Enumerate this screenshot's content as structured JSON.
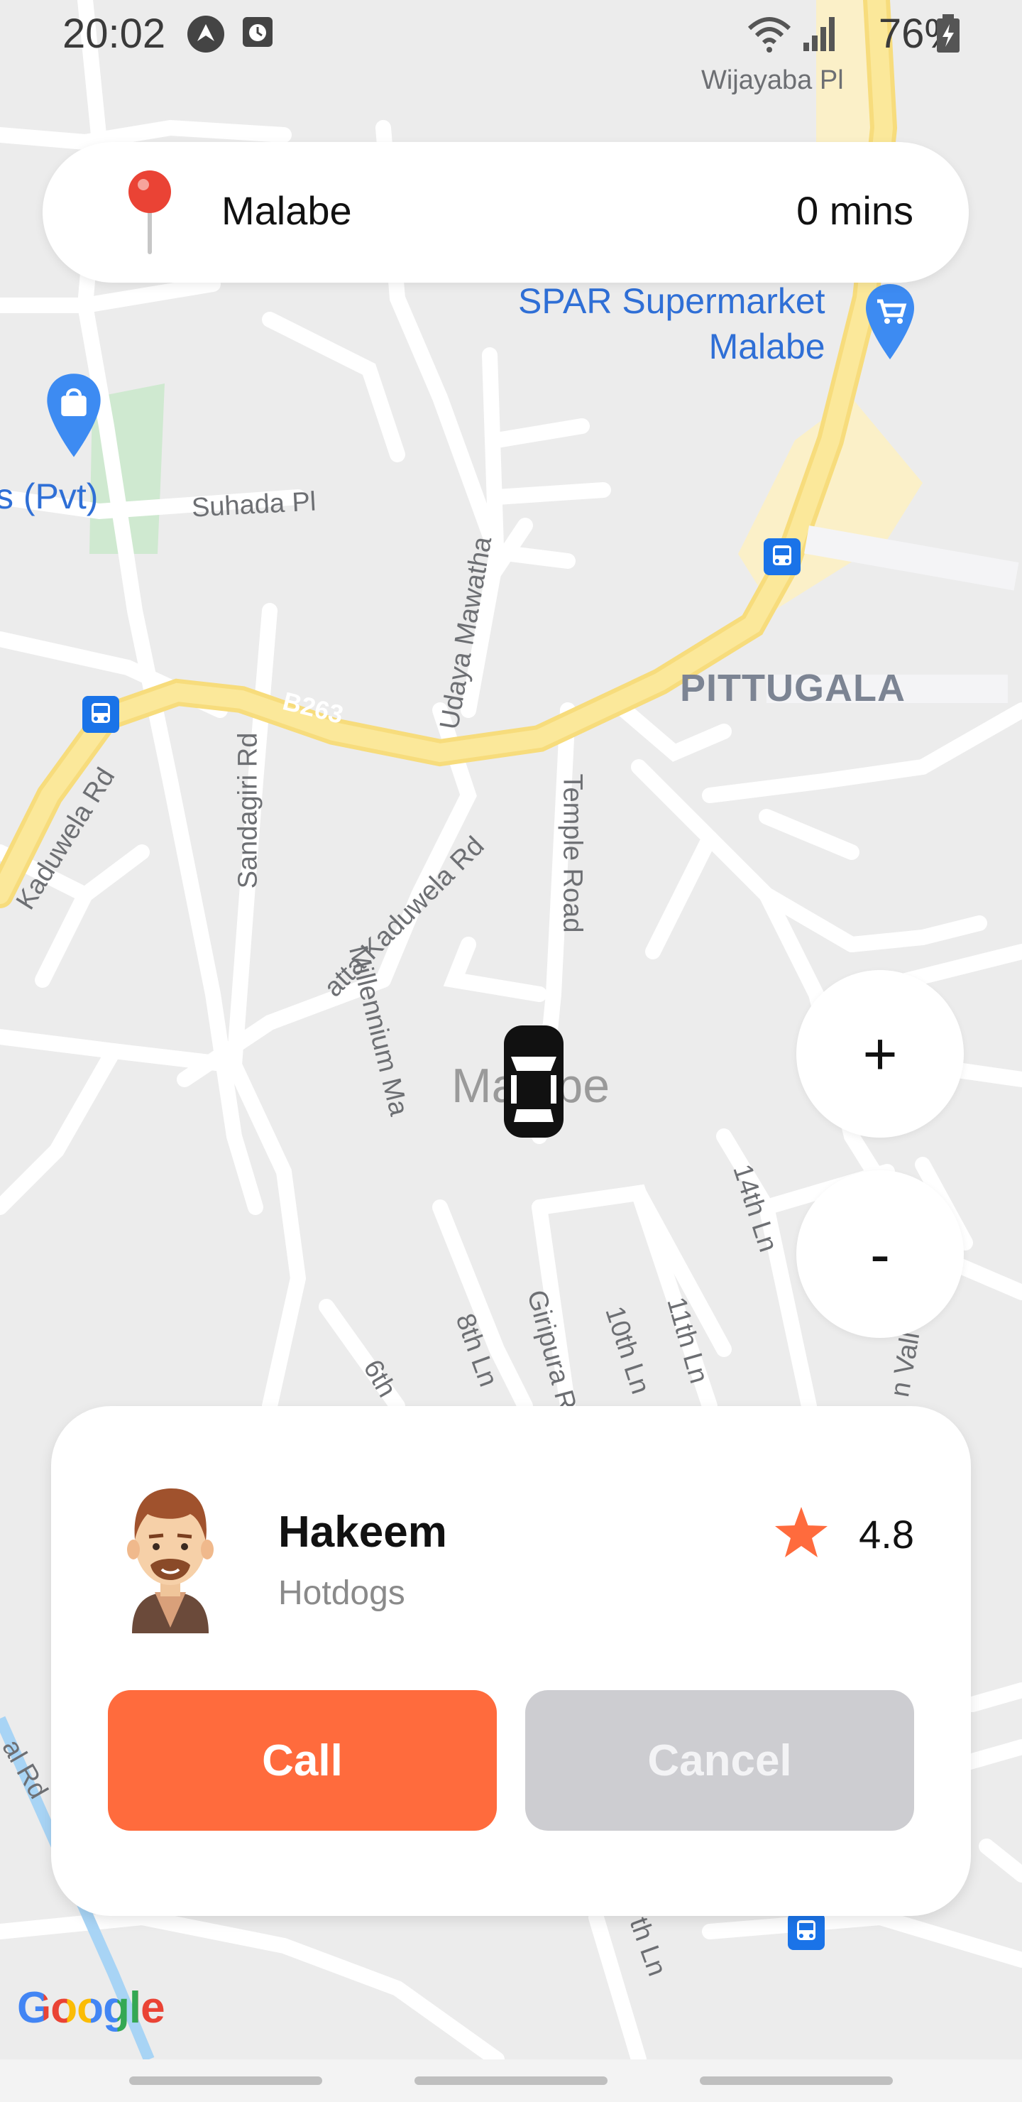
{
  "status_bar": {
    "time": "20:02",
    "battery": "76%"
  },
  "destination": {
    "name": "Malabe",
    "eta": "0 mins"
  },
  "map": {
    "area_label": "PITTUGALA",
    "city_label": "Malabe",
    "poi_spar": "SPAR Supermarket\nMalabe",
    "poi_pvt": "s (Pvt)",
    "roads": {
      "wijayaba": "Wijayaba Pl",
      "suhada": "Suhada Pl",
      "b263": "B263",
      "kaduwela_rd": "Kaduwela Rd",
      "udaya": "Udaya Mawatha",
      "sandagiri": "Sandagiri Rd",
      "temple": "Temple Road",
      "atta_kaduwela": "atta Kaduwela Rd",
      "millennium": "Millennium Ma",
      "fourteenth": "14th Ln",
      "eighth": "8th Ln",
      "giripura": "Giripura R",
      "tenth": "10th Ln",
      "eleventh": "11th Ln",
      "sixth": "6th",
      "n_vall": "n Vall",
      "al_rd": "al Rd",
      "th_ln": "th Ln"
    },
    "brand": "Google"
  },
  "zoom": {
    "plus": "+",
    "minus": "-"
  },
  "driver": {
    "name": "Hakeem",
    "subtitle": "Hotdogs",
    "rating": "4.8"
  },
  "actions": {
    "call": "Call",
    "cancel": "Cancel"
  },
  "colors": {
    "accent": "#ff6b3d",
    "cancel_bg": "#cdcdd1",
    "main_road": "#fbe89a",
    "poi_blue": "#2f6fd6",
    "star": "#ff6b3d"
  },
  "icons": [
    "wifi-icon",
    "signal-icon",
    "battery-icon",
    "map-pin-icon",
    "car-icon",
    "shopping-bag-icon",
    "cart-icon",
    "bus-stop-icon",
    "star-icon",
    "avatar"
  ]
}
